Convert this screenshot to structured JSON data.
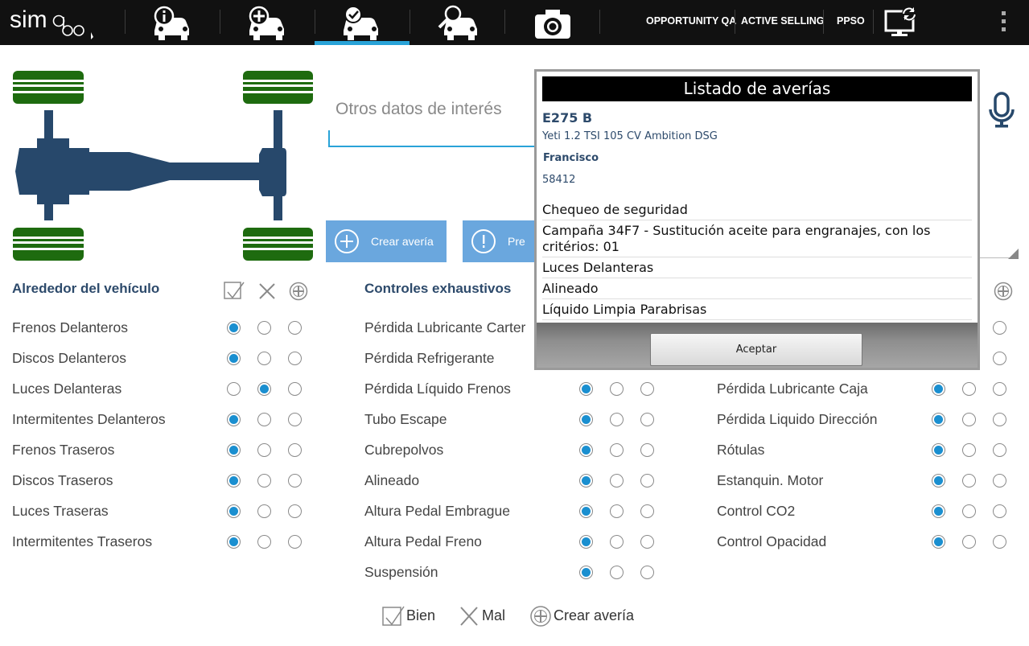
{
  "topbar": {
    "logo_text": "simgo",
    "links": [
      "OPPORTUNITY QA",
      "ACTIVE SELLING",
      "PPSO"
    ],
    "tab_icons": [
      "car-info-icon",
      "car-add-icon",
      "car-check-icon",
      "car-search-icon",
      "camera-icon"
    ],
    "active_tab": 2,
    "accent_color": "#29a3d8"
  },
  "form": {
    "otros_label": "Otros datos de interés",
    "crear_averia_label": "Crear avería",
    "second_button_label": "Pre"
  },
  "sections": {
    "alrededor": {
      "title": "Alrededor del vehículo",
      "rows": [
        {
          "label": "Frenos Delanteros",
          "state": "bien"
        },
        {
          "label": "Discos Delanteros",
          "state": "bien"
        },
        {
          "label": "Luces Delanteras",
          "state": "mal"
        },
        {
          "label": "Intermitentes Delanteros",
          "state": "bien"
        },
        {
          "label": "Frenos Traseros",
          "state": "bien"
        },
        {
          "label": "Discos Traseros",
          "state": "bien"
        },
        {
          "label": "Luces Traseras",
          "state": "bien"
        },
        {
          "label": "Intermitentes Traseros",
          "state": "bien"
        }
      ]
    },
    "exhaustivos": {
      "title": "Controles exhaustivos",
      "rows": [
        {
          "label": "Pérdida Lubricante Carter",
          "state": "bien"
        },
        {
          "label": "Pérdida Refrigerante",
          "state": "bien"
        },
        {
          "label": "Pérdida Líquido Frenos",
          "state": "bien"
        },
        {
          "label": "Tubo Escape",
          "state": "bien"
        },
        {
          "label": "Cubrepolvos",
          "state": "bien"
        },
        {
          "label": "Alineado",
          "state": "bien"
        },
        {
          "label": "Altura Pedal Embrague",
          "state": "bien"
        },
        {
          "label": "Altura Pedal Freno",
          "state": "bien"
        },
        {
          "label": "Suspensión",
          "state": "bien"
        }
      ]
    },
    "tercera": {
      "rows": [
        {
          "label": "",
          "state": "bien"
        },
        {
          "label": "",
          "state": "bien"
        },
        {
          "label": "Pérdida Lubricante Caja",
          "state": "bien"
        },
        {
          "label": "Pérdida Liquido Dirección",
          "state": "bien"
        },
        {
          "label": "Rótulas",
          "state": "bien"
        },
        {
          "label": "Estanquin. Motor",
          "state": "bien"
        },
        {
          "label": "Control CO2",
          "state": "bien"
        },
        {
          "label": "Control Opacidad",
          "state": "bien"
        }
      ]
    }
  },
  "legend": {
    "bien": "Bien",
    "mal": "Mal",
    "crear": "Crear avería"
  },
  "dialog": {
    "title": "Listado de averías",
    "plate": "E275 B",
    "model": "Yeti 1.2 TSI 105 CV Ambition DSG",
    "client": "Francisco",
    "number": "58412",
    "items": [
      "Chequeo de seguridad",
      "Campaña 34F7 - Sustitución aceite para engranajes, con los critérios: 01",
      "Luces Delanteras",
      "Alineado",
      "Líquido Limpia Parabrisas"
    ],
    "ok_label": "Aceptar"
  },
  "colors": {
    "title_blue": "#2d4a6b",
    "radio_on": "#1a8fd0",
    "button_blue": "#6aa7de",
    "tire_green": "#1e6b0f",
    "chassis_blue": "#27486b"
  }
}
